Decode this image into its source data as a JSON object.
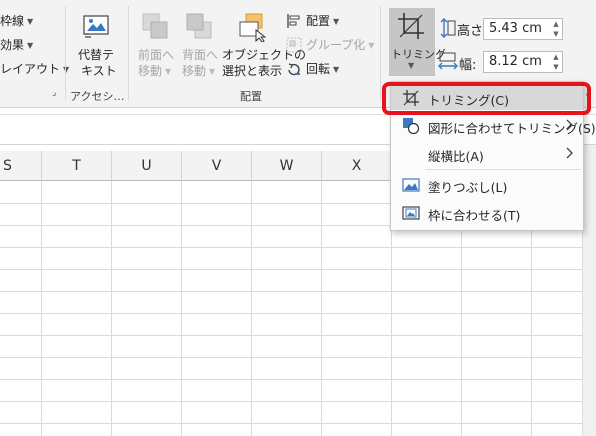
{
  "ribbon": {
    "left_group": {
      "items": [
        "枠線",
        "効果",
        "レイアウト"
      ],
      "dialog_launcher": "⌟"
    },
    "accessibility": {
      "alt_text_label": "代替テ\nキスト",
      "alt_text_line1": "代替テ",
      "alt_text_line2": "キスト",
      "group_label": "アクセシ…"
    },
    "arrange": {
      "bring_forward_line1": "前面へ",
      "bring_forward_line2": "移動",
      "send_backward_line1": "背面へ",
      "send_backward_line2": "移動",
      "selection_pane_line1": "オブジェクトの",
      "selection_pane_line2": "選択と表示",
      "align": "配置",
      "group": "グループ化",
      "rotate": "回転",
      "group_label": "配置"
    },
    "size": {
      "crop_label": "トリミング",
      "height_label": "高さ:",
      "height_value": "5.43 cm",
      "width_label": "幅:",
      "width_value": "8.12 cm"
    }
  },
  "grid": {
    "columns": [
      "S",
      "T",
      "U",
      "V",
      "W",
      "X"
    ]
  },
  "crop_menu": {
    "items": [
      {
        "label": "トリミング(C)",
        "icon": "crop-icon",
        "has_submenu": false,
        "highlighted": true
      },
      {
        "label": "図形に合わせてトリミング(S)",
        "icon": "crop-to-shape-icon",
        "has_submenu": true,
        "highlighted": false
      },
      {
        "label": "縦横比(A)",
        "icon": "",
        "has_submenu": true,
        "highlighted": false
      },
      {
        "label": "塗りつぶし(L)",
        "icon": "fill-picture-icon",
        "has_submenu": false,
        "highlighted": false
      },
      {
        "label": "枠に合わせる(T)",
        "icon": "fit-picture-icon",
        "has_submenu": false,
        "highlighted": false
      }
    ]
  },
  "colors": {
    "highlight_border": "#e8121c",
    "ribbon_bg": "#f3f3f3",
    "menu_highlight": "#d8d8d8"
  }
}
